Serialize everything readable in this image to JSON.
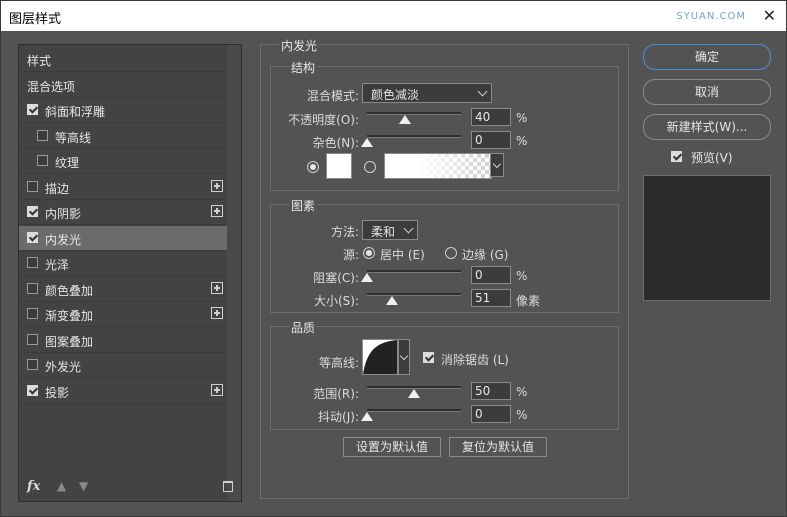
{
  "window": {
    "title": "图层样式",
    "watermark": "SYUAN.COM"
  },
  "left_panel": {
    "items": [
      {
        "label": "样式",
        "checkbox": false,
        "plus": false,
        "indent": false
      },
      {
        "label": "混合选项",
        "checkbox": false,
        "plus": false,
        "indent": false
      },
      {
        "label": "斜面和浮雕",
        "checkbox": true,
        "checked": true,
        "plus": false,
        "indent": false
      },
      {
        "label": "等高线",
        "checkbox": true,
        "checked": false,
        "plus": false,
        "indent": true
      },
      {
        "label": "纹理",
        "checkbox": true,
        "checked": false,
        "plus": false,
        "indent": true
      },
      {
        "label": "描边",
        "checkbox": true,
        "checked": false,
        "plus": true,
        "indent": false
      },
      {
        "label": "内阴影",
        "checkbox": true,
        "checked": true,
        "plus": true,
        "indent": false
      },
      {
        "label": "内发光",
        "checkbox": true,
        "checked": true,
        "plus": false,
        "indent": false,
        "selected": true
      },
      {
        "label": "光泽",
        "checkbox": true,
        "checked": false,
        "plus": false,
        "indent": false
      },
      {
        "label": "颜色叠加",
        "checkbox": true,
        "checked": false,
        "plus": true,
        "indent": false
      },
      {
        "label": "渐变叠加",
        "checkbox": true,
        "checked": false,
        "plus": true,
        "indent": false
      },
      {
        "label": "图案叠加",
        "checkbox": true,
        "checked": false,
        "plus": false,
        "indent": false
      },
      {
        "label": "外发光",
        "checkbox": true,
        "checked": false,
        "plus": false,
        "indent": false
      },
      {
        "label": "投影",
        "checkbox": true,
        "checked": true,
        "plus": true,
        "indent": false
      }
    ],
    "footer": {
      "fx": "fx"
    }
  },
  "inner_glow": {
    "section_title": "内发光",
    "structure": {
      "title": "结构",
      "blend_mode_label": "混合模式:",
      "blend_mode_value": "颜色减淡",
      "opacity_label": "不透明度(O):",
      "opacity_value": "40",
      "opacity_level": 0.4,
      "noise_label": "杂色(N):",
      "noise_value": "0",
      "noise_level": 0,
      "percent": "%"
    },
    "elements": {
      "title": "图素",
      "method_label": "方法:",
      "method_value": "柔和",
      "source_label": "源:",
      "source_center": "居中 (E)",
      "source_edge": "边缘 (G)",
      "choke_label": "阻塞(C):",
      "choke_value": "0",
      "choke_level": 0,
      "size_label": "大小(S):",
      "size_value": "51",
      "size_unit": "像素"
    },
    "quality": {
      "title": "品质",
      "contour_label": "等高线:",
      "anti_alias_label": "消除锯齿 (L)",
      "range_label": "范围(R):",
      "range_value": "50",
      "range_level": 0.5,
      "jitter_label": "抖动(J):",
      "jitter_value": "0",
      "jitter_level": 0
    },
    "buttons": {
      "make_default": "设置为默认值",
      "reset_default": "复位为默认值"
    }
  },
  "right_panel": {
    "ok": "确定",
    "cancel": "取消",
    "new_style": "新建样式(W)...",
    "preview_label": "预览(V)"
  }
}
